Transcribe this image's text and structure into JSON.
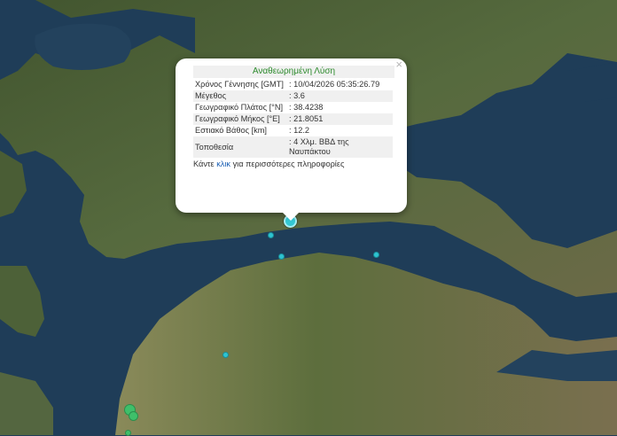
{
  "popup": {
    "title": "Αναθεωρημένη Λύση",
    "close_symbol": "×",
    "rows": [
      {
        "label": "Χρόνος Γέννησης [GMT]",
        "value": ": 10/04/2026 05:35:26.79"
      },
      {
        "label": "Μέγεθος",
        "value": ": 3.6"
      },
      {
        "label": "Γεωγραφικό Πλάτος [°N]",
        "value": ": 38.4238"
      },
      {
        "label": "Γεωγραφικό Μήκος [°E]",
        "value": ": 21.8051"
      },
      {
        "label": "Εστιακό Βάθος [km]",
        "value": ": 12.2"
      },
      {
        "label": "Τοποθεσία",
        "value": ": 4 Χλμ. ΒΒΔ της Ναυπάκτου"
      }
    ],
    "more_prefix": "Κάντε ",
    "more_link": "κλικ",
    "more_suffix": " για περισσότερες πληροφορίες"
  },
  "colors": {
    "sea": "#1f3d58",
    "land": "#4c5f3a",
    "quake_cyan": "#2ec3d1",
    "quake_green": "#3fbf6a",
    "title_green": "#2e8b2e"
  }
}
